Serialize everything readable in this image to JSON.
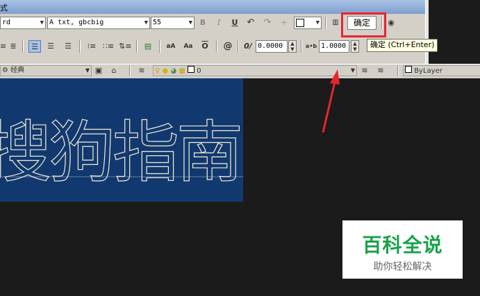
{
  "dialog": {
    "title_fragment": "式",
    "style_value": "rd",
    "font_value": "txt, gbcbig",
    "height_value": "55",
    "ok_label": "确定",
    "tooltip": "确定 (Ctrl+Enter)",
    "oblique_value": "0.0000",
    "tracking_value": "1.0000",
    "toolbar_labels": {
      "bold": "B",
      "italic": "I",
      "underline": "U",
      "uppercase": "aA",
      "lowercase": "Aa",
      "overline": "O",
      "symbol": "@",
      "oblique": "0/",
      "tracking": "a•b"
    }
  },
  "layerbar": {
    "workspace": "经典",
    "layer": "0",
    "linetype": "ByLayer"
  },
  "canvas": {
    "mtext": "搜狗指南",
    "text_color": "#f1ebd4",
    "box_color": "#12396f"
  },
  "watermark": {
    "title": "百科全说",
    "subtitle": "助你轻松解决",
    "color": "#1aa24a"
  },
  "annotation": {
    "highlight_color": "#e8242c"
  }
}
